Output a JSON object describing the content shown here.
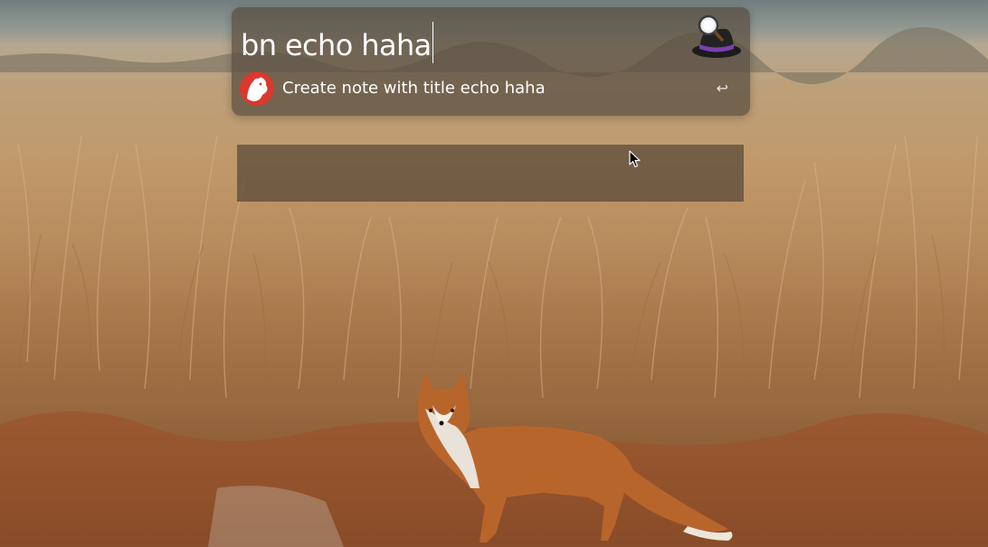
{
  "launcher": {
    "query": "bn echo haha",
    "app_icon": "alfred-hat-icon",
    "result": {
      "icon": "bear-app-icon",
      "title": "Create note with title echo haha",
      "action_icon": "return-key-icon",
      "action_glyph": "↩"
    }
  },
  "wallpaper": {
    "subject": "fox-in-grassland"
  },
  "colors": {
    "launcher_bg": "#584c40",
    "text": "#ffffff",
    "bear_red": "#d9392f",
    "hat_band": "#7a3fb0"
  }
}
